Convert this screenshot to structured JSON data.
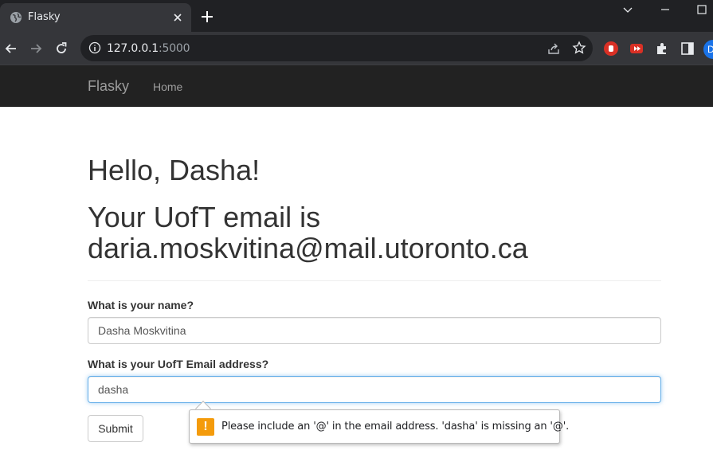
{
  "browser": {
    "tab_title": "Flasky",
    "url_host": "127.0.0.1",
    "url_port": ":5000",
    "profile_initial": "D"
  },
  "navbar": {
    "brand": "Flasky",
    "home_label": "Home"
  },
  "main": {
    "greeting": "Hello, Dasha!",
    "email_text": "Your UofT email is daria.moskvitina@mail.utoronto.ca"
  },
  "form": {
    "name_label": "What is your name?",
    "name_value": "Dasha Moskvitina",
    "email_label": "What is your UofT Email address?",
    "email_value": "dasha",
    "submit_label": "Submit"
  },
  "validation": {
    "icon": "warning-icon",
    "message": "Please include an '@' in the email address. 'dasha' is missing an '@'."
  },
  "colors": {
    "navbar_bg": "#222222",
    "chrome_frame": "#202124",
    "chrome_toolbar": "#35363a",
    "focus_border": "#66afe9",
    "warning": "#f49b0b"
  }
}
